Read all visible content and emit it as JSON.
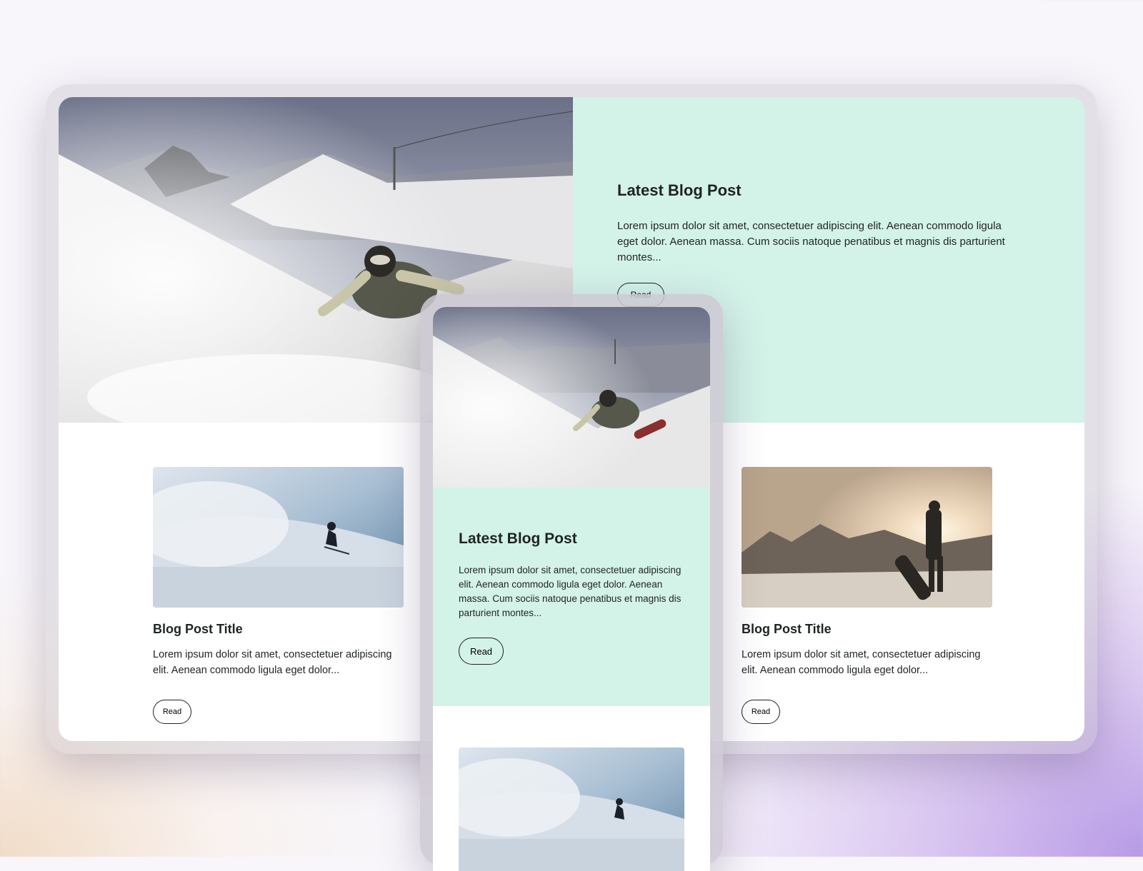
{
  "desktop": {
    "hero": {
      "title": "Latest Blog Post",
      "excerpt": "Lorem ipsum dolor sit amet, consectetuer adipiscing elit. Aenean commodo ligula eget dolor. Aenean massa. Cum sociis natoque penatibus et magnis dis parturient montes...",
      "read_label": "Read",
      "image": "snowboarder-carving-ski-slope-photo"
    },
    "cards": [
      {
        "title": "Blog Post Title",
        "excerpt": "Lorem ipsum dolor sit amet, consectetuer adipiscing elit. Aenean commodo ligula eget dolor...",
        "read_label": "Read",
        "image": "snowboarder-powder-spray-photo"
      },
      {
        "title": "Blog Post Title",
        "excerpt": "Lorem ipsum dolor sit amet, consectetuer adipiscing elit. Aenean commodo ligula eget dolor...",
        "read_label": "Read",
        "image": "snowboarder-sunset-mountains-photo"
      }
    ]
  },
  "mobile": {
    "hero": {
      "title": "Latest Blog Post",
      "excerpt": "Lorem ipsum dolor sit amet, consectetuer adipiscing elit. Aenean commodo ligula eget dolor. Aenean massa. Cum sociis natoque penatibus et magnis dis parturient montes...",
      "read_label": "Read",
      "image": "snowboarder-carving-ski-slope-photo"
    },
    "card": {
      "image": "snowboarder-powder-spray-photo"
    }
  },
  "colors": {
    "accent_panel": "#d3f2e8",
    "text": "#1f2424",
    "card_background": "#ffffff"
  }
}
